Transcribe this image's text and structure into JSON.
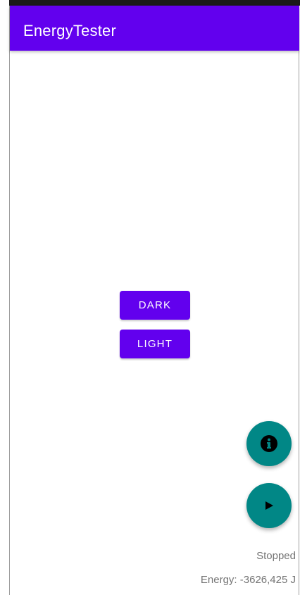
{
  "app": {
    "title": "EnergyTester"
  },
  "buttons": {
    "dark_label": "DARK",
    "light_label": "LIGHT"
  },
  "fabs": {
    "info_icon": "info-icon",
    "play_icon": "play-icon"
  },
  "status": {
    "state_text": "Stopped",
    "energy_text": "Energy: -3626,425 J"
  },
  "colors": {
    "primary": "#6200ee",
    "secondary": "#018786",
    "text_secondary": "#757575"
  }
}
